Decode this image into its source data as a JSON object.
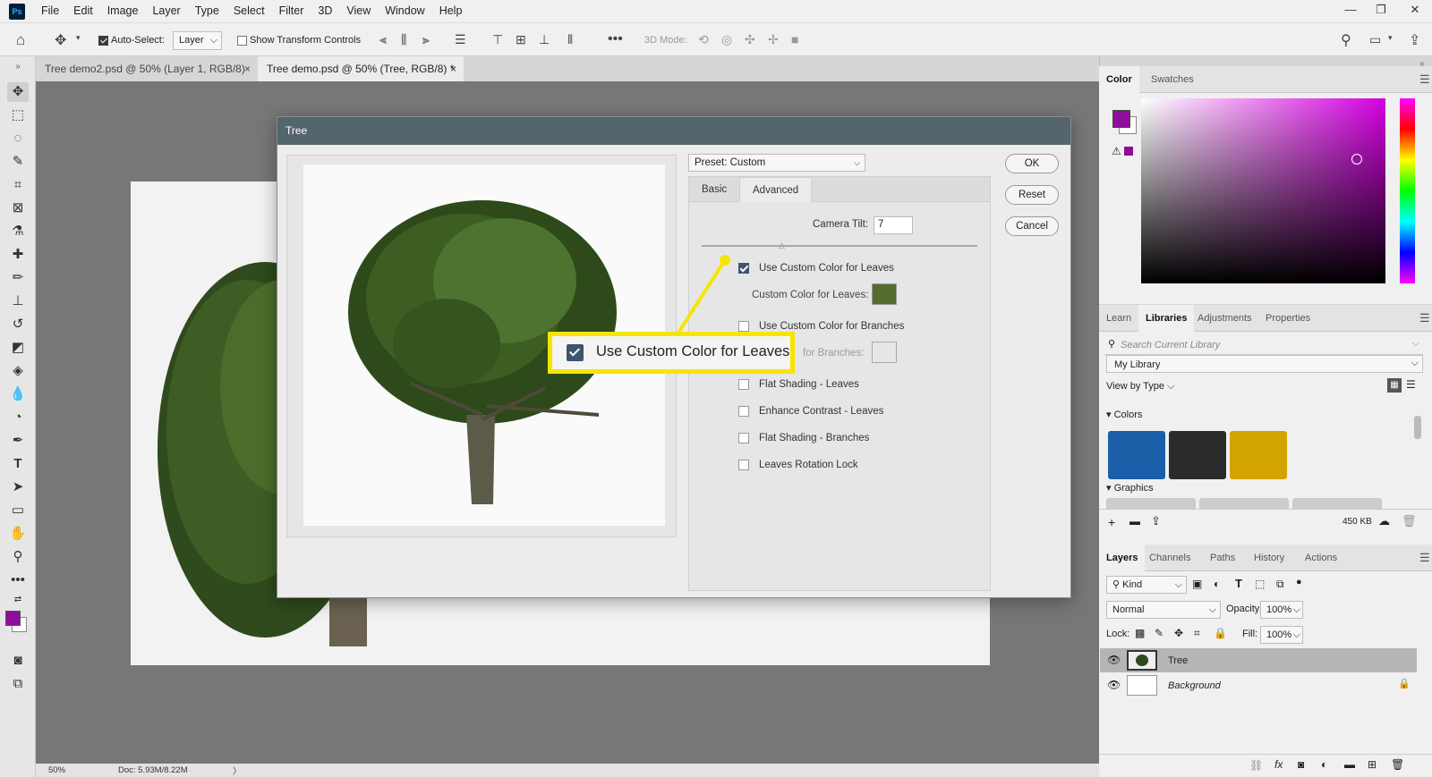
{
  "menubar": {
    "logo": "Ps",
    "items": [
      "File",
      "Edit",
      "Image",
      "Layer",
      "Type",
      "Select",
      "Filter",
      "3D",
      "View",
      "Window",
      "Help"
    ]
  },
  "options": {
    "auto_select_label": "Auto-Select:",
    "auto_select_value": "Layer",
    "show_transform_label": "Show Transform Controls",
    "mode_3d_label": "3D Mode:"
  },
  "tabs": [
    {
      "label": "Tree demo2.psd @ 50% (Layer 1, RGB/8)",
      "close": "×"
    },
    {
      "label": "Tree demo.psd @ 50% (Tree, RGB/8) *",
      "close": "×"
    }
  ],
  "status": {
    "zoom": "50%",
    "doc": "Doc: 5.93M/8.22M",
    "arrow": "〉"
  },
  "dialog": {
    "title": "Tree",
    "preset": "Preset: Custom",
    "tabs": [
      "Basic",
      "Advanced"
    ],
    "camera_tilt_label": "Camera Tilt:",
    "camera_tilt_value": "7",
    "options": [
      {
        "label": "Use Custom Color for Leaves",
        "checked": true
      },
      {
        "label": "Use Custom Color for Branches",
        "checked": false
      },
      {
        "label": "Flat Shading - Leaves",
        "checked": false
      },
      {
        "label": "Enhance Contrast - Leaves",
        "checked": false
      },
      {
        "label": "Flat Shading - Branches",
        "checked": false
      },
      {
        "label": "Leaves Rotation Lock",
        "checked": false
      }
    ],
    "leaf_color_label": "Custom Color for Leaves:",
    "leaf_color": "#556b2f",
    "branch_color_label_visible": "for Branches:",
    "buttons": {
      "ok": "OK",
      "reset": "Reset",
      "cancel": "Cancel"
    }
  },
  "callout": {
    "label": "Use Custom Color for Leaves",
    "color": "#f6e500"
  },
  "color_panel": {
    "tabs": [
      "Color",
      "Swatches"
    ],
    "foreground": "#8e0e9a",
    "background": "#ffffff"
  },
  "libraries_panel": {
    "tabs": [
      "Learn",
      "Libraries",
      "Adjustments",
      "Properties"
    ],
    "search_placeholder": "Search Current Library",
    "library": "My Library",
    "view_by": "View by Type",
    "colors_heading": "Colors",
    "swatches": [
      "#1a5fa8",
      "#2b2b2b",
      "#d3a400"
    ],
    "graphics_heading": "Graphics",
    "size": "450 KB"
  },
  "layers_panel": {
    "tabs": [
      "Layers",
      "Channels",
      "Paths",
      "History",
      "Actions"
    ],
    "kind": "Kind",
    "blend_mode": "Normal",
    "opacity_label": "Opacity:",
    "opacity_value": "100%",
    "lock_label": "Lock:",
    "fill_label": "Fill:",
    "fill_value": "100%",
    "layers": [
      {
        "name": "Tree",
        "selected": true
      },
      {
        "name": "Background",
        "selected": false
      }
    ]
  }
}
